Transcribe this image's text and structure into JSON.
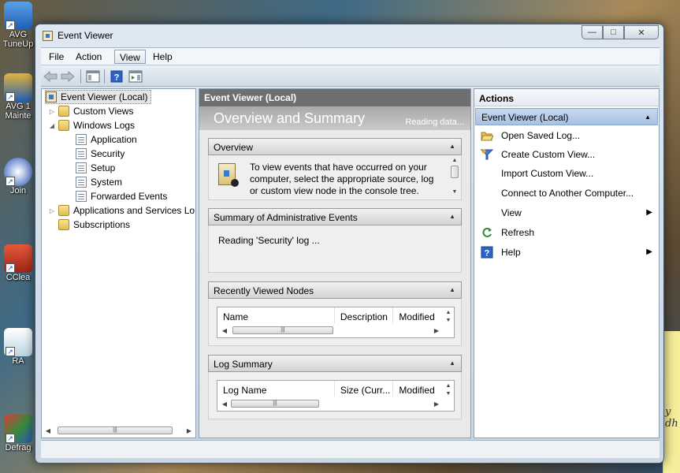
{
  "desktop": {
    "icons": [
      {
        "label": "AVG",
        "sub": "TuneUp",
        "color": "#2a6fc0"
      },
      {
        "label": "AVG 1",
        "sub": "Mainte",
        "color": "#1f5fb5"
      },
      {
        "label": "Join",
        "sub": "",
        "color": "#2a57b8"
      },
      {
        "label": "CClea",
        "sub": "",
        "color": "#c43a2a"
      },
      {
        "label": "RA",
        "sub": "",
        "color": "#e9f2f6"
      },
      {
        "label": "Defrag",
        "sub": "",
        "color": "#b83232"
      }
    ],
    "sticky_text": "y\ndh"
  },
  "window": {
    "title": "Event Viewer",
    "caption": {
      "minimize": "—",
      "maximize": "□",
      "close": "✕"
    }
  },
  "menu": [
    "File",
    "Action",
    "View",
    "Help"
  ],
  "menu_active": "View",
  "toolbar": {
    "buttons": [
      "back-arrow-icon",
      "forward-arrow-icon",
      "show-hide-console-tree-icon",
      "help-icon",
      "show-hide-action-pane-icon"
    ]
  },
  "tree": {
    "root": "Event Viewer (Local)",
    "custom_views": "Custom Views",
    "windows_logs": "Windows Logs",
    "logs": [
      "Application",
      "Security",
      "Setup",
      "System",
      "Forwarded Events"
    ],
    "apps_services": "Applications and Services Lo",
    "subscriptions": "Subscriptions"
  },
  "center": {
    "header": "Event Viewer (Local)",
    "banner_title": "Overview and Summary",
    "banner_status": "Reading data...",
    "sections": {
      "overview": {
        "title": "Overview",
        "text": "To view events that have occurred on your computer, select the appropriate source, log or custom view node in the console tree."
      },
      "summary": {
        "title": "Summary of Administrative Events",
        "text": "Reading 'Security' log ..."
      },
      "recent": {
        "title": "Recently Viewed Nodes",
        "columns": [
          "Name",
          "Description",
          "Modified"
        ]
      },
      "log_summary": {
        "title": "Log Summary",
        "columns": [
          "Log Name",
          "Size (Curr...",
          "Modified"
        ]
      }
    }
  },
  "actions": {
    "header": "Actions",
    "group": "Event Viewer (Local)",
    "items": [
      {
        "label": "Open Saved Log...",
        "icon": "folder-open-icon",
        "submenu": false
      },
      {
        "label": "Create Custom View...",
        "icon": "filter-icon",
        "submenu": false
      },
      {
        "label": "Import Custom View...",
        "icon": "",
        "submenu": false
      },
      {
        "label": "Connect to Another Computer...",
        "icon": "",
        "submenu": false
      },
      {
        "label": "View",
        "icon": "",
        "submenu": true
      },
      {
        "label": "Refresh",
        "icon": "refresh-icon",
        "submenu": false
      },
      {
        "label": "Help",
        "icon": "help-icon",
        "submenu": true
      }
    ]
  },
  "colors": {
    "accent": "#a8c1e2",
    "panel_header": "#6f6f6f"
  }
}
